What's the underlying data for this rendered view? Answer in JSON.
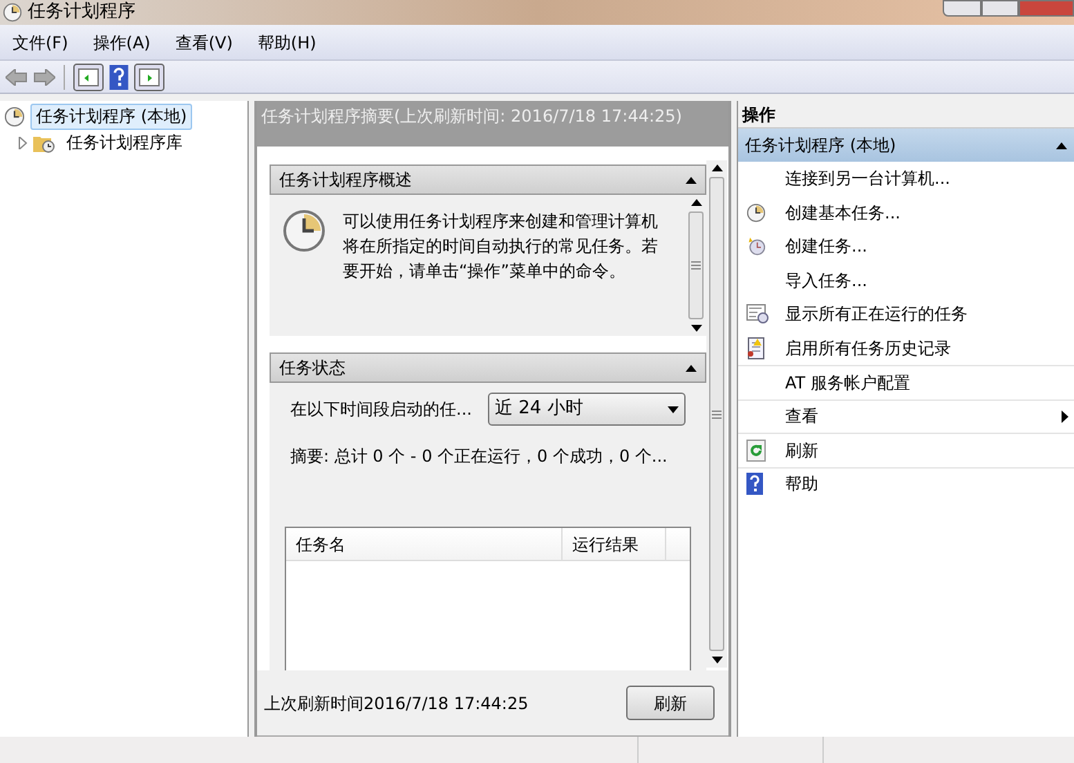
{
  "window": {
    "title": "任务计划程序"
  },
  "menu": [
    {
      "label": "文件(F)"
    },
    {
      "label": "操作(A)"
    },
    {
      "label": "查看(V)"
    },
    {
      "label": "帮助(H)"
    }
  ],
  "tree": [
    {
      "label": "任务计划程序 (本地)",
      "selected": true,
      "expanded": true,
      "children": [
        {
          "label": "任务计划程序库",
          "selected": false,
          "expanded": false
        }
      ]
    }
  ],
  "summary": {
    "header": "任务计划程序摘要(上次刷新时间: 2016/7/18 17:44:25)",
    "overview": {
      "title": "任务计划程序概述",
      "expanded": true,
      "text": "可以使用任务计划程序来创建和管理计算机将在所指定的时间自动执行的常见任务。若要开始，请单击“操作”菜单中的命令。"
    },
    "status": {
      "title": "任务状态",
      "expanded": true,
      "period_label": "在以下时间段启动的任...",
      "period_value": "近 24 小时",
      "summary": "摘要: 总计 0 个 - 0 个正在运行，0 个成功，0 个...",
      "columns": [
        "任务名",
        "运行结果"
      ]
    },
    "last_refresh": "上次刷新时间2016/7/18 17:44:25",
    "refresh_button": "刷新"
  },
  "actions": {
    "title": "操作",
    "section": {
      "label": "任务计划程序 (本地)",
      "expanded": true
    },
    "items": [
      {
        "label": "连接到另一台计算机...",
        "kind": "plain"
      },
      {
        "label": "创建基本任务...",
        "kind": "create-basic"
      },
      {
        "label": "创建任务...",
        "kind": "create"
      },
      {
        "label": "导入任务...",
        "kind": "plain"
      },
      {
        "label": "显示所有正在运行的任务",
        "kind": "running"
      },
      {
        "label": "启用所有任务历史记录",
        "kind": "history"
      },
      {
        "label": "AT 服务帐户配置",
        "kind": "plain"
      },
      {
        "label": "查看",
        "kind": "submenu"
      },
      {
        "label": "刷新",
        "kind": "refresh"
      },
      {
        "label": "帮助",
        "kind": "help"
      }
    ]
  }
}
